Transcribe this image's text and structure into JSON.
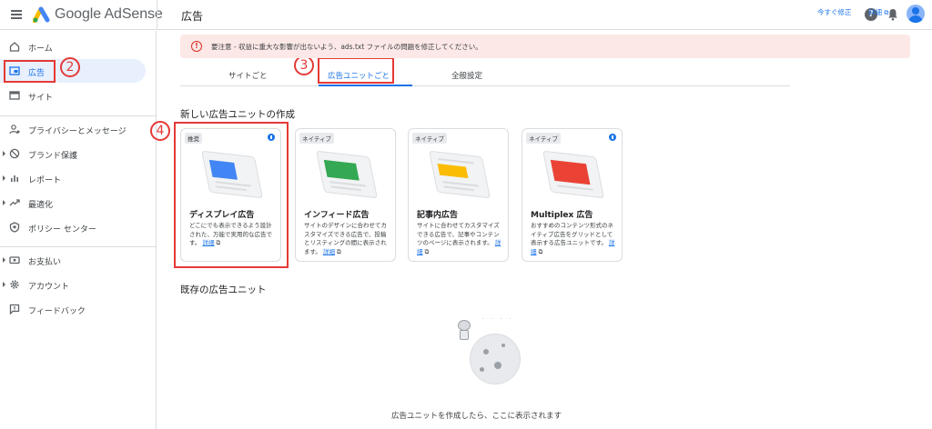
{
  "header": {
    "brand": "Google AdSense",
    "page_title": "広告",
    "help_glyph": "?"
  },
  "sidebar": {
    "items": [
      {
        "label": "ホーム",
        "icon": "home-icon"
      },
      {
        "label": "広告",
        "icon": "ads-icon",
        "active": true
      },
      {
        "label": "サイト",
        "icon": "sites-icon"
      },
      {
        "label": "プライバシーとメッセージ",
        "icon": "privacy-icon"
      },
      {
        "label": "ブランド保護",
        "icon": "block-icon"
      },
      {
        "label": "レポート",
        "icon": "reports-icon"
      },
      {
        "label": "最適化",
        "icon": "trending-icon"
      },
      {
        "label": "ポリシー センター",
        "icon": "shield-icon"
      },
      {
        "label": "お支払い",
        "icon": "payments-icon"
      },
      {
        "label": "アカウント",
        "icon": "gear-icon"
      },
      {
        "label": "フィードバック",
        "icon": "feedback-icon"
      }
    ]
  },
  "annotations": {
    "step2": "2",
    "step3": "3",
    "step4": "4"
  },
  "warning": {
    "glyph": "!",
    "text": "要注意 - 収益に重大な影響が出ないよう、ads.txt ファイルの問題を修正してください。",
    "fix_label": "今すぐ修正",
    "detail_label": "詳細",
    "ext_glyph": "⧉"
  },
  "tabs": [
    {
      "label": "サイトごと"
    },
    {
      "label": "広告ユニットごと",
      "active": true
    },
    {
      "label": "全般設定"
    }
  ],
  "new_section": {
    "heading": "新しい広告ユニットの作成",
    "cards": [
      {
        "tag": "推奨",
        "title": "ディスプレイ広告",
        "desc": "どこにでも表示できるよう設計された、万能で実用的な広告です。",
        "link": "詳細",
        "color": "#4285f4",
        "badge": true
      },
      {
        "tag": "ネイティブ",
        "title": "インフィード広告",
        "desc": "サイトのデザインに合わせてカスタマイズできる広告で、投稿とリスティングの間に表示されます。",
        "link": "詳細",
        "color": "#34a853",
        "badge": false
      },
      {
        "tag": "ネイティブ",
        "title": "記事内広告",
        "desc": "サイトに合わせてカスタマイズできる広告で、記事やコンテンツのページに表示されます。",
        "link": "詳細",
        "color": "#fbbc04",
        "badge": false
      },
      {
        "tag": "ネイティブ",
        "title": "Multiplex 広告",
        "desc": "おすすめのコンテンツ形式のネイティブ広告をグリッドとして表示する広告ユニットです。",
        "link": "詳細",
        "color": "#ea4335",
        "badge": true
      }
    ]
  },
  "existing_section": {
    "heading": "既存の広告ユニット",
    "empty_text": "広告ユニットを作成したら、ここに表示されます"
  }
}
